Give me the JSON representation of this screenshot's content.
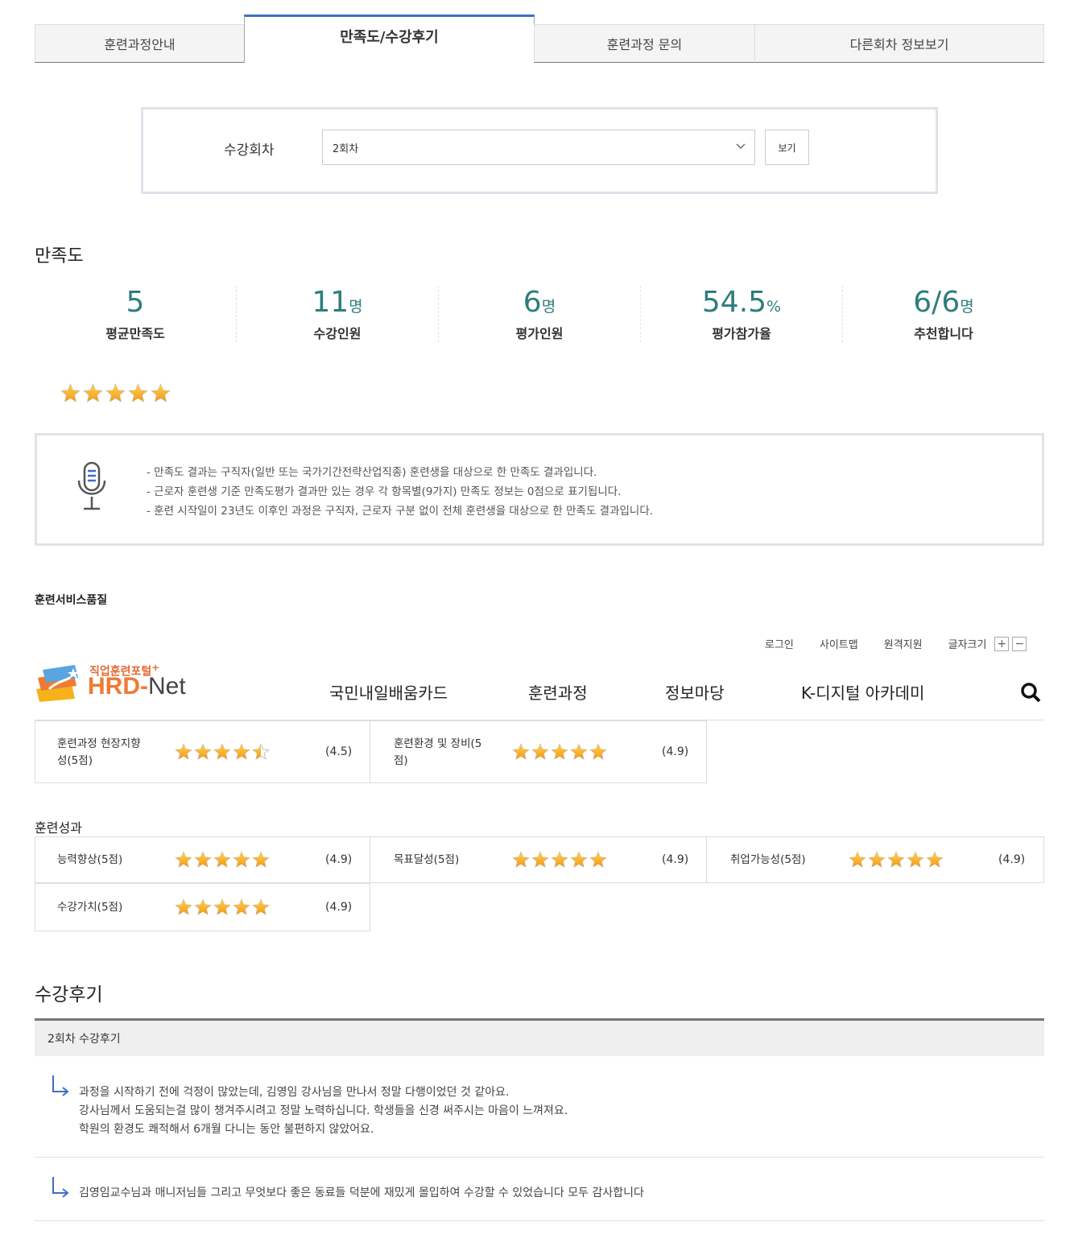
{
  "tabs": [
    {
      "label": "훈련과정안내",
      "active": false
    },
    {
      "label": "만족도/수강후기",
      "active": true
    },
    {
      "label": "훈련과정 문의",
      "active": false
    },
    {
      "label": "다른회차 정보보기",
      "active": false
    }
  ],
  "session": {
    "label": "수강회차",
    "selected": "2회차",
    "button": "보기"
  },
  "satisfaction": {
    "title": "만족도",
    "stats": [
      {
        "value": "5",
        "unit": "",
        "label": "평균만족도"
      },
      {
        "value": "11",
        "unit": "명",
        "label": "수강인원"
      },
      {
        "value": "6",
        "unit": "명",
        "label": "평가인원"
      },
      {
        "value": "54.5",
        "unit": "%",
        "label": "평가참가율"
      },
      {
        "value": "6/6",
        "unit": "명",
        "label": "추천합니다"
      }
    ],
    "star_rating": 5
  },
  "notice": [
    "- 만족도 결과는 구직자(일반 또는 국가기간전략산업직종) 훈련생을 대상으로 한 만족도 결과입니다.",
    "- 근로자 훈련생 기준 만족도평가 결과만 있는 경우 각 항목별(9가지) 만족도 정보는 0점으로 표기됩니다.",
    "- 훈련 시작일이 23년도 이후인 과정은 구직자, 근로자 구분 없이 전체 훈련생을 대상으로 한 만족도 결과입니다."
  ],
  "cut_heading": "훈련서비스품질",
  "overlay_header": {
    "links": [
      "로그인",
      "사이트맵",
      "원격지원"
    ],
    "font_size_label": "글자크기",
    "plus": "+",
    "minus": "−",
    "logo_sub": "직업훈련포털",
    "logo_plus": "+",
    "logo_hrd": "HRD",
    "logo_dash": "-",
    "logo_net": "Net",
    "nav": [
      "국민내일배움카드",
      "훈련과정",
      "정보마당",
      "K-디지털 아카데미"
    ],
    "search_icon": "search-icon"
  },
  "ratings_service": [
    {
      "label_l1": "훈련과정 현장지향",
      "label_l2": "성(5점)",
      "value": "(4.5)",
      "stars": 4.5
    },
    {
      "label_l1": "훈련환경 및 장비(5",
      "label_l2": "점)",
      "value": "(4.9)",
      "stars": 5
    }
  ],
  "outcome": {
    "title": "훈련성과",
    "items": [
      {
        "label": "능력향상(5점)",
        "value": "(4.9)",
        "stars": 5
      },
      {
        "label": "목표달성(5점)",
        "value": "(4.9)",
        "stars": 5
      },
      {
        "label": "취업가능성(5점)",
        "value": "(4.9)",
        "stars": 5
      },
      {
        "label": "수강가치(5점)",
        "value": "(4.9)",
        "stars": 5
      }
    ]
  },
  "reviews": {
    "title": "수강후기",
    "header": "2회차 수강후기",
    "items": [
      [
        "과정을 시작하기 전에 걱정이 많았는데, 김영임 강사님을 만나서 정말 다행이었던 것 같아요.",
        "강사님께서 도움되는걸 많이 챙겨주시려고 정말 노력하십니다. 학생들을 신경 써주시는 마음이 느껴져요.",
        "학원의 환경도 쾌적해서 6개월 다니는 동안 불편하지 않았어요."
      ],
      [
        "김영임교수님과 매니저님들 그리고 무엇보다 좋은 동료들 덕분에 재밌게 몰입하여 수강할 수 있었습니다 모두 감사합니다"
      ]
    ]
  },
  "colors": {
    "accent": "#3d6fc4",
    "stat": "#2e7d7d",
    "star": "#f6a623",
    "logo": "#ef7a33"
  }
}
